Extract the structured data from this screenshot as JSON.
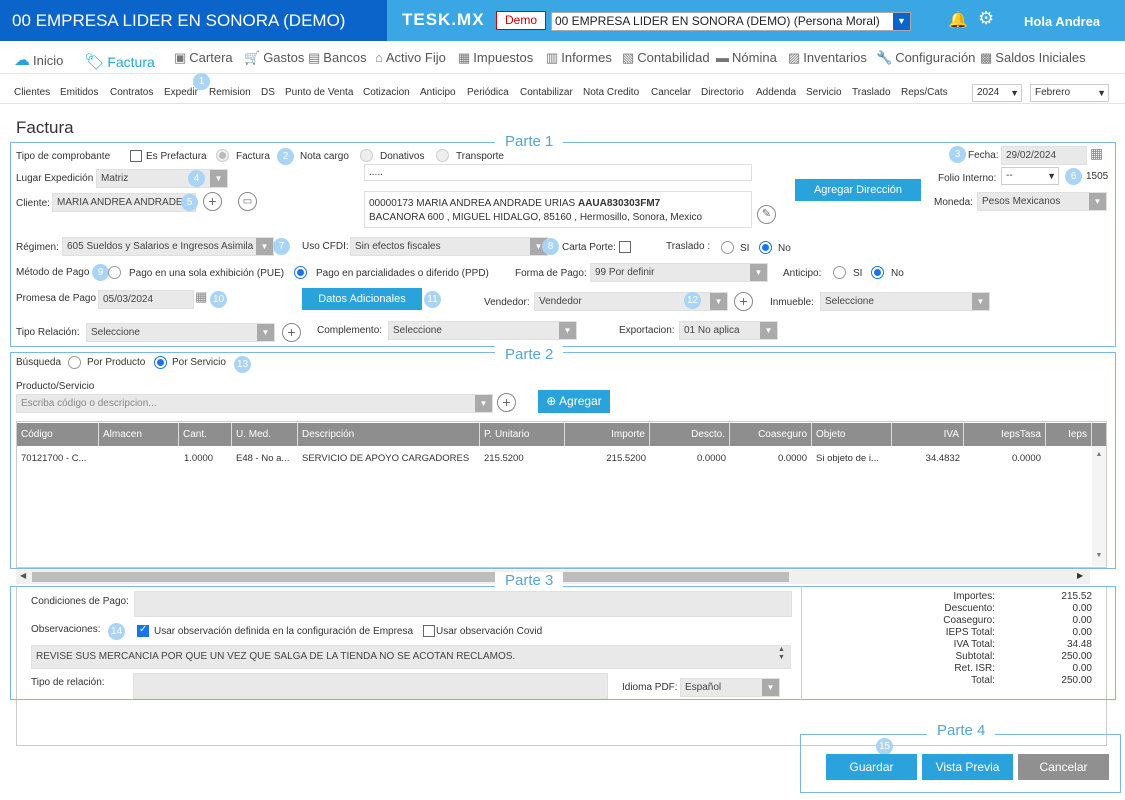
{
  "header": {
    "company": "00 EMPRESA LIDER EN SONORA (DEMO)",
    "brand": "TESK.MX",
    "demo": "Demo",
    "company_select": "00 EMPRESA LIDER EN SONORA (DEMO) (Persona Moral)",
    "greeting": "Hola Andrea"
  },
  "menu": [
    "Inicio",
    "Factura",
    "Cartera",
    "Gastos",
    "Bancos",
    "Activo Fijo",
    "Impuestos",
    "Informes",
    "Contabilidad",
    "Nómina",
    "Inventarios",
    "Configuración",
    "Saldos Iniciales"
  ],
  "submenu": [
    "Clientes",
    "Emitidos",
    "Contratos",
    "Expedir",
    "Remision",
    "DS",
    "Punto de Venta",
    "Cotizacion",
    "Anticipo",
    "Periódica",
    "Contabilizar",
    "Nota Credito",
    "Cancelar",
    "Directorio",
    "Addenda",
    "Servicio",
    "Traslado",
    "Reps/Cats"
  ],
  "year": "2024",
  "month": "Febrero",
  "page_title": "Factura",
  "parts": [
    "Parte 1",
    "Parte 2",
    "Parte 3",
    "Parte 4"
  ],
  "steps": [
    "1",
    "2",
    "3",
    "4",
    "5",
    "6",
    "7",
    "8",
    "9",
    "10",
    "11",
    "12",
    "13",
    "14",
    "15"
  ],
  "p1": {
    "tipo_label": "Tipo de comprobante",
    "es_prefactura": "Es Prefactura",
    "factura": "Factura",
    "nota_cargo": "Nota cargo",
    "donativos": "Donativos",
    "transporte": "Transporte",
    "fecha_label": "Fecha:",
    "fecha": "29/02/2024",
    "lugar_label": "Lugar Expedición",
    "lugar": "Matriz",
    "dots": ".....",
    "folio_label": "Folio Interno:",
    "folio": "--",
    "folio_num": "1505",
    "cliente_label": "Cliente:",
    "cliente": "MARIA ANDREA ANDRADE U",
    "addr_line1": "00000173 MARIA ANDREA ANDRADE URIAS",
    "addr_rfc": "AAUA830303FM7",
    "addr_line2": "BACANORA 600 , MIGUEL HIDALGO, 85160 , Hermosillo, Sonora, Mexico",
    "agregar_dir": "Agregar Dirección",
    "moneda_label": "Moneda:",
    "moneda": "Pesos Mexicanos",
    "regimen_label": "Régimen:",
    "regimen": "605 Sueldos y Salarios e Ingresos Asimila",
    "uso_label": "Uso CFDI:",
    "uso": "Sin efectos fiscales",
    "carta_label": "Carta Porte:",
    "traslado_label": "Traslado :",
    "si": "SI",
    "no": "No",
    "metodo_label": "Método de Pago",
    "pue": "Pago en una sola exhibición (PUE)",
    "ppd": "Pago en parcialidades o diferido (PPD)",
    "forma_label": "Forma de Pago:",
    "forma": "99  Por definir",
    "anticipo_label": "Anticipo:",
    "promesa_label": "Promesa de Pago",
    "promesa": "05/03/2024",
    "datos_btn": "Datos Adicionales",
    "vendedor_label": "Vendedor:",
    "vendedor": "Vendedor",
    "inmueble_label": "Inmueble:",
    "inmueble": "Seleccione",
    "tiporel_label": "Tipo Relación:",
    "tiporel": "Seleccione",
    "complemento_label": "Complemento:",
    "complemento": "Seleccione",
    "export_label": "Exportacion:",
    "export": "01 No aplica"
  },
  "p2": {
    "busqueda": "Búsqueda",
    "por_producto": "Por Producto",
    "por_servicio": "Por Servicio",
    "prod_label": "Producto/Servicio",
    "prod_placeholder": "Escriba código o descripcion...",
    "agregar": "Agregar",
    "columns": [
      "Código",
      "Almacen",
      "Cant.",
      "U. Med.",
      "Descripción",
      "P. Unitario",
      "Importe",
      "Descto.",
      "Coaseguro",
      "Objeto",
      "IVA",
      "IepsTasa",
      "Ieps"
    ],
    "row": [
      "70121700 - C...",
      "",
      "1.0000",
      "E48 - No a...",
      "SERVICIO DE APOYO CARGADORES",
      "215.5200",
      "215.5200",
      "0.0000",
      "0.0000",
      "Si objeto de i...",
      "34.4832",
      "0.0000"
    ]
  },
  "p3": {
    "condiciones_label": "Condiciones de Pago:",
    "obs_label": "Observaciones:",
    "obs_empresa": "Usar observación definida en la configuración de Empresa",
    "obs_covid": "Usar observación Covid",
    "obs_text": "REVISE SUS MERCANCIA POR QUE UN VEZ  QUE SALGA DE LA TIENDA NO SE ACOTAN RECLAMOS.",
    "tiporel_label": "Tipo de relación:",
    "idioma_label": "Idioma PDF:",
    "idioma": "Español"
  },
  "totals": [
    [
      "Importes:",
      "215.52"
    ],
    [
      "Descuento:",
      "0.00"
    ],
    [
      "Coaseguro:",
      "0.00"
    ],
    [
      "IEPS Total:",
      "0.00"
    ],
    [
      "IVA Total:",
      "34.48"
    ],
    [
      "Subtotal:",
      "250.00"
    ],
    [
      "Ret. ISR:",
      "0.00"
    ],
    [
      "Total:",
      "250.00"
    ]
  ],
  "p4": {
    "guardar": "Guardar",
    "vista": "Vista Previa",
    "cancelar": "Cancelar"
  }
}
